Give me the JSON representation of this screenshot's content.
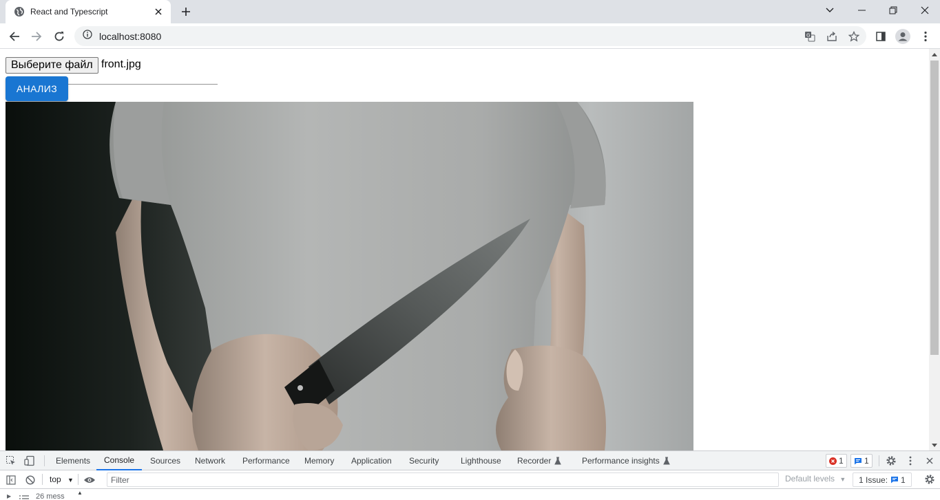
{
  "tab": {
    "title": "React and Typescript"
  },
  "address": {
    "url": "localhost:8080"
  },
  "page": {
    "file_button": "Выберите файл",
    "file_name": "front.jpg",
    "analyze_button": "АНАЛИЗ"
  },
  "devtools": {
    "tabs": [
      "Elements",
      "Console",
      "Sources",
      "Network",
      "Performance",
      "Memory",
      "Application",
      "Security",
      "Lighthouse",
      "Recorder",
      "Performance insights"
    ],
    "active_tab": "Console",
    "errors_count": "1",
    "messages_count": "1",
    "context": "top",
    "filter_placeholder": "Filter",
    "levels": "Default levels",
    "issues_label": "1 Issue:",
    "issues_count": "1",
    "messages_summary": "26 mess"
  },
  "colors": {
    "accent": "#1976d2",
    "devtools_active": "#1a73e8",
    "error": "#d93025"
  }
}
